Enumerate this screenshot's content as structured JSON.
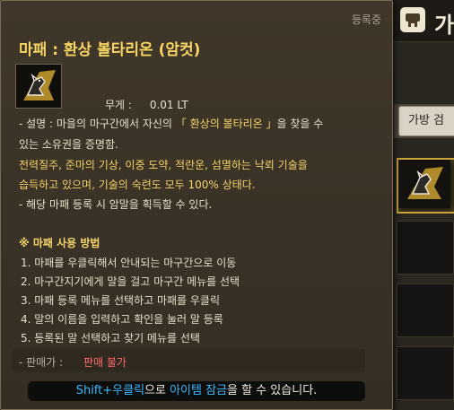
{
  "background_window": {
    "header_title": "가",
    "tab_label": "가방 검"
  },
  "tooltip": {
    "registered_tag": "등록중",
    "title": "마패 : 환상 볼타리온 (암컷)",
    "weight": {
      "label": "무게 :",
      "value": "0.01 LT"
    },
    "description": {
      "prefix": "- 설명 : ",
      "line1_pre": "마을의 마구간에서 자신의 ",
      "line1_quote": "「 환상의 볼타리온 」",
      "line1_post": "을 찾을 수",
      "line2": "있는 소유권을 증명함.",
      "skills_line1": "전력질주, 준마의 기상, 이중 도약, 적란운, 섬멸하는 낙뢰 기술을",
      "skills_line2": "습득하고 있으며, 기술의 숙련도 모두 100% 상태다.",
      "note": "- 해당 마패 등록 시 암말을 획득할 수 있다."
    },
    "usage": {
      "title": "※ 마패 사용 방법",
      "steps": [
        "1. 마패를 우클릭해서 안내되는 마구간으로 이동",
        "2. 마구간지기에게 말을 걸고 마구간 메뉴를 선택",
        "3. 마패 등록 메뉴를 선택하고 마패를 우클릭",
        "4. 말의 이름을 입력하고 확인을 눌러 말 등록",
        "5. 등록된 말 선택하고 찾기 메뉴를 선택"
      ]
    },
    "price": {
      "label": "- 판매가 :",
      "value": "판매 불가"
    },
    "hint": {
      "key": "Shift+우클릭",
      "mid": "으로 ",
      "action": "아이템 잠금",
      "end": "을 할 수 있습니다."
    }
  },
  "icons": {
    "item": "horse-badge-icon",
    "header": "stable-icon"
  },
  "colors": {
    "title": "#f7d564",
    "skills": "#f3d36a",
    "price_value": "#ff6d6d",
    "hint_highlight": "#3fb8ff",
    "tooltip_bg": "#3a3226"
  }
}
